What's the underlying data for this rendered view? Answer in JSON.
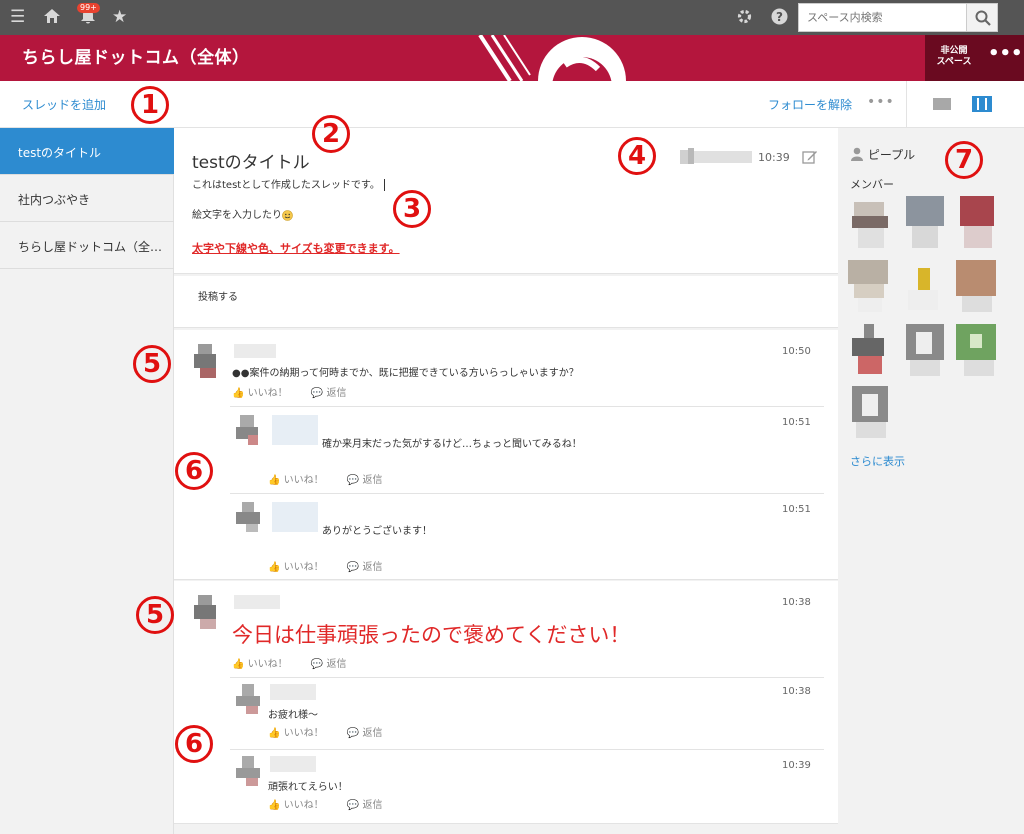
{
  "topbar": {
    "notification_badge": "99+",
    "search_placeholder": "スペース内検索"
  },
  "banner": {
    "title": "ちらし屋ドットコム（全体）",
    "private_line1": "非公開",
    "private_line2": "スペース",
    "more": "•••"
  },
  "subbar": {
    "add_thread": "スレッドを追加",
    "unfollow": "フォローを解除",
    "more": "•••"
  },
  "sidebar": {
    "items": [
      {
        "label": "testのタイトル"
      },
      {
        "label": "社内つぶやき"
      },
      {
        "label": "ちらし屋ドットコム（全…"
      }
    ]
  },
  "post": {
    "title": "testのタイトル",
    "body": "これはtestとして作成したスレッドです。",
    "emoji_text": "絵文字を入力したり",
    "red_text": "太字や下線や色、サイズも変更できます。",
    "time": "10:39"
  },
  "composer": {
    "label": "投稿する"
  },
  "actions": {
    "like": "いいね！",
    "reply": "返信"
  },
  "threads": [
    {
      "time": "10:50",
      "message": "●●案件の納期って何時までか、既に把握できている方いらっしゃいますか？",
      "replies": [
        {
          "time": "10:51",
          "message": "確か来月末だった気がするけど…ちょっと聞いてみるね！"
        },
        {
          "time": "10:51",
          "message": "ありがとうございます！"
        }
      ]
    },
    {
      "time": "10:38",
      "message": "今日は仕事頑張ったので褒めてください！",
      "replies": [
        {
          "time": "10:38",
          "message": "お疲れ様～"
        },
        {
          "time": "10:39",
          "message": "頑張れてえらい！"
        }
      ]
    }
  ],
  "rightpanel": {
    "people": "ピープル",
    "members": "メンバー",
    "show_more": "さらに表示"
  },
  "annotations": [
    "1",
    "2",
    "3",
    "4",
    "5",
    "6",
    "7",
    "5",
    "6"
  ],
  "colors": {
    "banner": "#b4163d",
    "accent": "#2d8bd0",
    "annotation": "#e01010"
  }
}
